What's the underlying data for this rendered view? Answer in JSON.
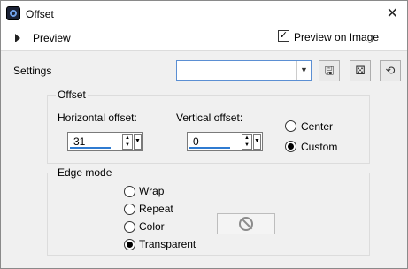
{
  "window": {
    "title": "Offset",
    "close_icon": "close-icon",
    "app_icon": "offset-app-icon"
  },
  "preview": {
    "label": "Preview",
    "preview_on_image_label": "Preview on Image",
    "preview_on_image_checked": true
  },
  "settings": {
    "label": "Settings",
    "preset_value": ""
  },
  "offset_group": {
    "title": "Offset",
    "horizontal_label": "Horizontal offset:",
    "horizontal_value": "31",
    "vertical_label": "Vertical offset:",
    "vertical_value": "0",
    "center_label": "Center",
    "custom_label": "Custom",
    "selected": "Custom"
  },
  "edge_mode": {
    "title": "Edge mode",
    "options": [
      "Wrap",
      "Repeat",
      "Color",
      "Transparent"
    ],
    "selected": "Transparent"
  }
}
